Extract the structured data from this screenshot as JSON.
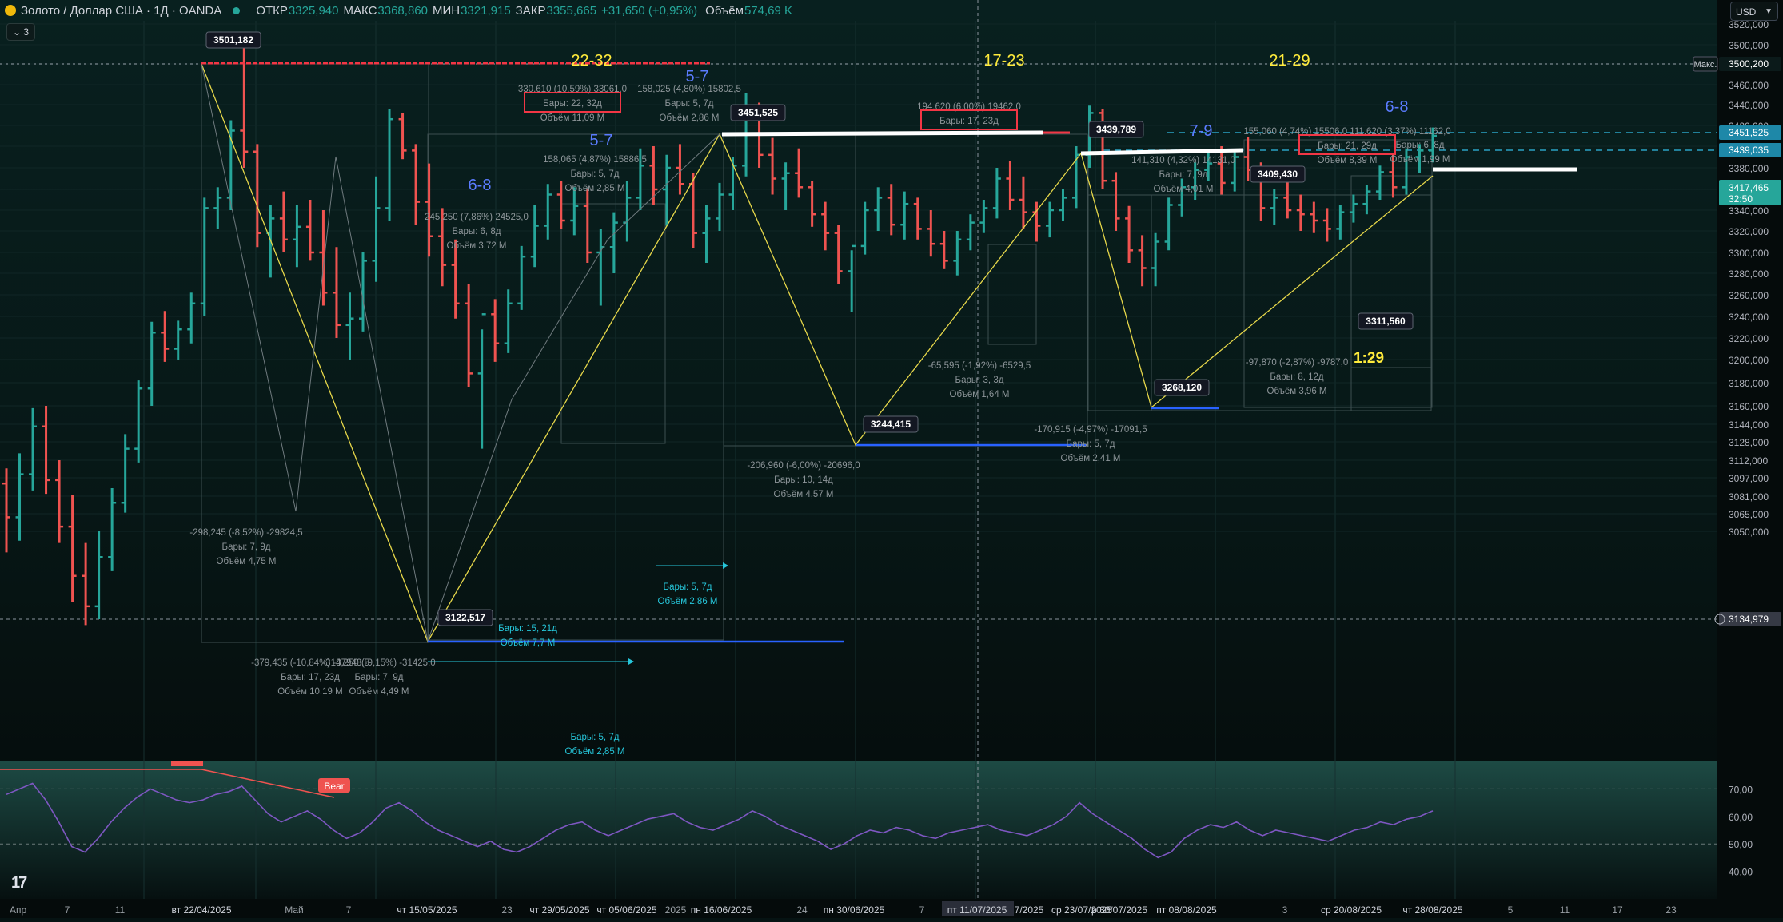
{
  "header": {
    "symbol": "Золото / Доллар США · 1Д · OANDA",
    "open_label": "ОТКР",
    "open_value": "3325,940",
    "high_label": "МАКС",
    "high_value": "3368,860",
    "low_label": "МИН",
    "low_value": "3321,915",
    "close_label": "ЗАКР",
    "close_value": "3355,665",
    "change": "+31,650 (+0,95%)",
    "volume_label": "Объём",
    "volume_value": "574,69 K",
    "collapse_label": "3",
    "currency": "USD"
  },
  "chart_data": {
    "type": "candlestick",
    "instrument": "Золото / Доллар США",
    "timeframe": "1Д",
    "y_ticks": [
      "3520,000",
      "3500,000",
      "3480,000",
      "3460,000",
      "3440,000",
      "3420,000",
      "3400,000",
      "3380,000",
      "3360,000",
      "3340,000",
      "3320,000",
      "3300,000",
      "3280,000",
      "3260,000",
      "3240,000",
      "3220,000",
      "3200,000",
      "3180,000",
      "3160,000",
      "3144,000",
      "3128,000",
      "3112,000",
      "3097,000",
      "3081,000",
      "3065,000",
      "3050,000"
    ],
    "x_ticks": [
      "Апр",
      "7",
      "11",
      "вт 22/04/2025",
      "Май",
      "7",
      "чт 15/05/2025",
      "23",
      "чт 29/05/2025",
      "чт 05/06/2025",
      "2025",
      "пн 16/06/2025",
      "24",
      "пн 30/06/2025",
      "7",
      "пт 11/07/2025",
      "7/2025",
      "ср 23/07/2025",
      "р 30/07/2025",
      "пт 08/08/2025",
      "3",
      "ср 20/08/2025",
      "чт 28/08/2025",
      "5",
      "11",
      "17",
      "23"
    ],
    "price_badges": [
      {
        "label": "Макс.",
        "value": "3500,200",
        "color": "#0b1a1a"
      },
      {
        "value": "3451,525",
        "color": "#1e88a8"
      },
      {
        "value": "3439,035",
        "color": "#1e88a8"
      },
      {
        "value": "3417,465",
        "sub": "32:50",
        "color": "#26a69a"
      },
      {
        "value": "3134,979",
        "color": "#363a45"
      }
    ],
    "point_labels": [
      "3501,182",
      "3451,525",
      "3439,789",
      "3409,430",
      "3244,415",
      "3122,517",
      "3268,120",
      "3311,560"
    ],
    "wave_labels": [
      {
        "text": "22-32",
        "color": "#ffeb3b"
      },
      {
        "text": "17-23",
        "color": "#ffeb3b"
      },
      {
        "text": "21-29",
        "color": "#ffeb3b"
      },
      {
        "text": "5-7",
        "color": "#5b7cff"
      },
      {
        "text": "5-7",
        "color": "#5b7cff"
      },
      {
        "text": "6-8",
        "color": "#5b7cff"
      },
      {
        "text": "7-9",
        "color": "#5b7cff"
      },
      {
        "text": "6-8",
        "color": "#5b7cff"
      },
      {
        "text": "1:29",
        "color": "#ffeb3b"
      }
    ],
    "measurements": [
      {
        "lines": [
          "330,610 (10,59%) 33061,0",
          "Бары: 22, 32д",
          "Объём 11,09 M"
        ]
      },
      {
        "lines": [
          "158,025 (4,80%) 15802,5",
          "Бары: 5, 7д",
          "Объём 2,86 M"
        ]
      },
      {
        "lines": [
          "194,620 (6,00%) 19462,0",
          "Бары: 17, 23д"
        ]
      },
      {
        "lines": [
          "155,060 (4,74%) 15506,0 111,620 (3,37%) 11162,0",
          "Бары: 21, 29д",
          "Объём 8,39 M"
        ]
      },
      {
        "lines": [
          "Бары: 6, 8д",
          "Объём 1,99 M"
        ]
      },
      {
        "lines": [
          "141,310 (4,32%) 14131,0",
          "Бары: 7, 9д",
          "Объём 4,01 M"
        ]
      },
      {
        "lines": [
          "158,065 (4,87%) 15886,5",
          "Бары: 5, 7д",
          "Объём 2,85 M"
        ]
      },
      {
        "lines": [
          "245,250 (7,86%) 24525,0",
          "Бары: 6, 8д",
          "Объём 3,72 M"
        ]
      },
      {
        "lines": [
          "-298,245 (-8,52%) -29824,5",
          "Бары: 7, 9д",
          "Объём 4,75 M"
        ]
      },
      {
        "lines": [
          "-379,435 (-10,84%) -37943,5",
          "Бары: 17, 23д",
          "Объём 10,19 M"
        ]
      },
      {
        "lines": [
          "-314,250 (-9,15%) -31425,0",
          "Бары: 7, 9д",
          "Объём 4,49 M"
        ]
      },
      {
        "lines": [
          "-206,960 (-6,00%) -20696,0",
          "Бары: 10, 14д",
          "Объём 4,57 M"
        ]
      },
      {
        "lines": [
          "-65,595 (-1,92%) -6529,5",
          "Бары: 3, 3д",
          "Объём 1,64 M"
        ]
      },
      {
        "lines": [
          "-170,915 (-4,97%) -17091,5",
          "Бары: 5, 7д",
          "Объём 2,41 M"
        ]
      },
      {
        "lines": [
          "-97,870 (-2,87%) -9787,0",
          "Бары: 8, 12д",
          "Объём 3,96 M"
        ]
      },
      {
        "lines": [
          "Бары: 15, 21д",
          "Объём 7,7 M"
        ],
        "color": "#26c6da"
      },
      {
        "lines": [
          "Бары: 5, 7д",
          "Объём 2,86 M"
        ],
        "color": "#26c6da"
      },
      {
        "lines": [
          "Бары: 5, 7д",
          "Объём 2,85 M"
        ],
        "color": "#26c6da"
      }
    ],
    "candles": [
      [
        3092,
        3105,
        3032,
        3062
      ],
      [
        3062,
        3118,
        3042,
        3100
      ],
      [
        3100,
        3158,
        3086,
        3142
      ],
      [
        3142,
        3160,
        3083,
        3095
      ],
      [
        3095,
        3112,
        3040,
        3054
      ],
      [
        3054,
        3082,
        2990,
        3012
      ],
      [
        3012,
        3040,
        2970,
        2986
      ],
      [
        2986,
        3050,
        2975,
        3028
      ],
      [
        3028,
        3088,
        3016,
        3075
      ],
      [
        3075,
        3135,
        3066,
        3122
      ],
      [
        3122,
        3182,
        3110,
        3175
      ],
      [
        3175,
        3235,
        3160,
        3225
      ],
      [
        3225,
        3245,
        3198,
        3210
      ],
      [
        3210,
        3236,
        3200,
        3228
      ],
      [
        3228,
        3262,
        3215,
        3252
      ],
      [
        3252,
        3352,
        3240,
        3342
      ],
      [
        3342,
        3362,
        3322,
        3352
      ],
      [
        3352,
        3425,
        3340,
        3415
      ],
      [
        3415,
        3501,
        3380,
        3395
      ],
      [
        3395,
        3402,
        3305,
        3318
      ],
      [
        3318,
        3345,
        3276,
        3332
      ],
      [
        3332,
        3358,
        3300,
        3312
      ],
      [
        3312,
        3345,
        3286,
        3324
      ],
      [
        3324,
        3350,
        3292,
        3300
      ],
      [
        3300,
        3340,
        3250,
        3262
      ],
      [
        3262,
        3305,
        3220,
        3232
      ],
      [
        3232,
        3262,
        3200,
        3238
      ],
      [
        3238,
        3300,
        3226,
        3292
      ],
      [
        3292,
        3372,
        3272,
        3342
      ],
      [
        3342,
        3436,
        3330,
        3426
      ],
      [
        3426,
        3432,
        3388,
        3396
      ],
      [
        3396,
        3402,
        3326,
        3348
      ],
      [
        3348,
        3384,
        3296,
        3315
      ],
      [
        3315,
        3342,
        3268,
        3288
      ],
      [
        3288,
        3312,
        3238,
        3252
      ],
      [
        3252,
        3270,
        3176,
        3188
      ],
      [
        3188,
        3228,
        3122,
        3242
      ],
      [
        3242,
        3256,
        3198,
        3215
      ],
      [
        3215,
        3265,
        3206,
        3252
      ],
      [
        3252,
        3306,
        3246,
        3296
      ],
      [
        3296,
        3345,
        3286,
        3325
      ],
      [
        3325,
        3365,
        3312,
        3355
      ],
      [
        3355,
        3368,
        3322,
        3330
      ],
      [
        3330,
        3362,
        3316,
        3344
      ],
      [
        3344,
        3360,
        3290,
        3300
      ],
      [
        3300,
        3322,
        3250,
        3305
      ],
      [
        3305,
        3338,
        3280,
        3328
      ],
      [
        3328,
        3368,
        3310,
        3352
      ],
      [
        3352,
        3398,
        3340,
        3382
      ],
      [
        3382,
        3400,
        3345,
        3360
      ],
      [
        3360,
        3392,
        3325,
        3380
      ],
      [
        3380,
        3402,
        3355,
        3365
      ],
      [
        3365,
        3375,
        3304,
        3318
      ],
      [
        3318,
        3345,
        3290,
        3332
      ],
      [
        3332,
        3366,
        3320,
        3355
      ],
      [
        3355,
        3390,
        3340,
        3382
      ],
      [
        3382,
        3452,
        3372,
        3432
      ],
      [
        3432,
        3442,
        3380,
        3392
      ],
      [
        3392,
        3408,
        3355,
        3370
      ],
      [
        3370,
        3385,
        3340,
        3375
      ],
      [
        3375,
        3398,
        3352,
        3362
      ],
      [
        3362,
        3368,
        3324,
        3336
      ],
      [
        3336,
        3348,
        3302,
        3318
      ],
      [
        3318,
        3326,
        3270,
        3282
      ],
      [
        3282,
        3302,
        3244,
        3306
      ],
      [
        3306,
        3348,
        3298,
        3340
      ],
      [
        3340,
        3362,
        3320,
        3352
      ],
      [
        3352,
        3365,
        3316,
        3326
      ],
      [
        3326,
        3358,
        3312,
        3346
      ],
      [
        3346,
        3352,
        3312,
        3322
      ],
      [
        3322,
        3340,
        3296,
        3308
      ],
      [
        3308,
        3320,
        3284,
        3292
      ],
      [
        3292,
        3320,
        3278,
        3312
      ],
      [
        3312,
        3336,
        3302,
        3328
      ],
      [
        3328,
        3350,
        3318,
        3342
      ],
      [
        3342,
        3380,
        3332,
        3370
      ],
      [
        3370,
        3386,
        3340,
        3350
      ],
      [
        3350,
        3372,
        3322,
        3338
      ],
      [
        3338,
        3348,
        3310,
        3325
      ],
      [
        3325,
        3348,
        3314,
        3340
      ],
      [
        3340,
        3360,
        3330,
        3352
      ],
      [
        3352,
        3400,
        3342,
        3392
      ],
      [
        3392,
        3439,
        3380,
        3432
      ],
      [
        3432,
        3436,
        3360,
        3368
      ],
      [
        3368,
        3376,
        3320,
        3332
      ],
      [
        3332,
        3344,
        3290,
        3302
      ],
      [
        3302,
        3316,
        3268,
        3285
      ],
      [
        3285,
        3318,
        3268,
        3310
      ],
      [
        3310,
        3352,
        3302,
        3345
      ],
      [
        3345,
        3370,
        3334,
        3362
      ],
      [
        3362,
        3385,
        3350,
        3378
      ],
      [
        3378,
        3395,
        3368,
        3384
      ],
      [
        3384,
        3400,
        3355,
        3366
      ],
      [
        3366,
        3395,
        3358,
        3390
      ],
      [
        3390,
        3409,
        3368,
        3378
      ],
      [
        3378,
        3385,
        3330,
        3342
      ],
      [
        3342,
        3360,
        3326,
        3352
      ],
      [
        3352,
        3368,
        3332,
        3340
      ],
      [
        3340,
        3355,
        3320,
        3336
      ],
      [
        3336,
        3348,
        3318,
        3330
      ],
      [
        3330,
        3342,
        3310,
        3322
      ],
      [
        3322,
        3345,
        3312,
        3338
      ],
      [
        3338,
        3355,
        3328,
        3346
      ],
      [
        3346,
        3364,
        3336,
        3358
      ],
      [
        3358,
        3382,
        3350,
        3376
      ],
      [
        3376,
        3392,
        3352,
        3362
      ],
      [
        3362,
        3398,
        3355,
        3390
      ],
      [
        3390,
        3402,
        3375,
        3396
      ],
      [
        3396,
        3418,
        3385,
        3410
      ]
    ],
    "rsi": {
      "levels": [
        70,
        50
      ],
      "ticks": [
        "70,00",
        "60,00",
        "50,00",
        "40,00"
      ],
      "ylim": [
        30,
        80
      ],
      "annotation": "Bear",
      "values": [
        68,
        70,
        72,
        66,
        58,
        49,
        47,
        52,
        58,
        63,
        67,
        70,
        68,
        66,
        65,
        66,
        68,
        69,
        71,
        66,
        61,
        58,
        60,
        62,
        59,
        55,
        52,
        54,
        58,
        63,
        65,
        62,
        58,
        55,
        53,
        51,
        49,
        51,
        48,
        47,
        49,
        52,
        55,
        57,
        58,
        55,
        53,
        55,
        57,
        59,
        60,
        61,
        58,
        56,
        55,
        57,
        59,
        62,
        60,
        57,
        55,
        53,
        51,
        48,
        50,
        53,
        55,
        54,
        56,
        55,
        53,
        52,
        54,
        55,
        56,
        57,
        55,
        54,
        53,
        55,
        57,
        60,
        65,
        61,
        58,
        55,
        52,
        48,
        45,
        47,
        52,
        55,
        57,
        56,
        58,
        55,
        53,
        55,
        54,
        53,
        52,
        51,
        53,
        55,
        56,
        58,
        57,
        59,
        60,
        62
      ]
    }
  }
}
